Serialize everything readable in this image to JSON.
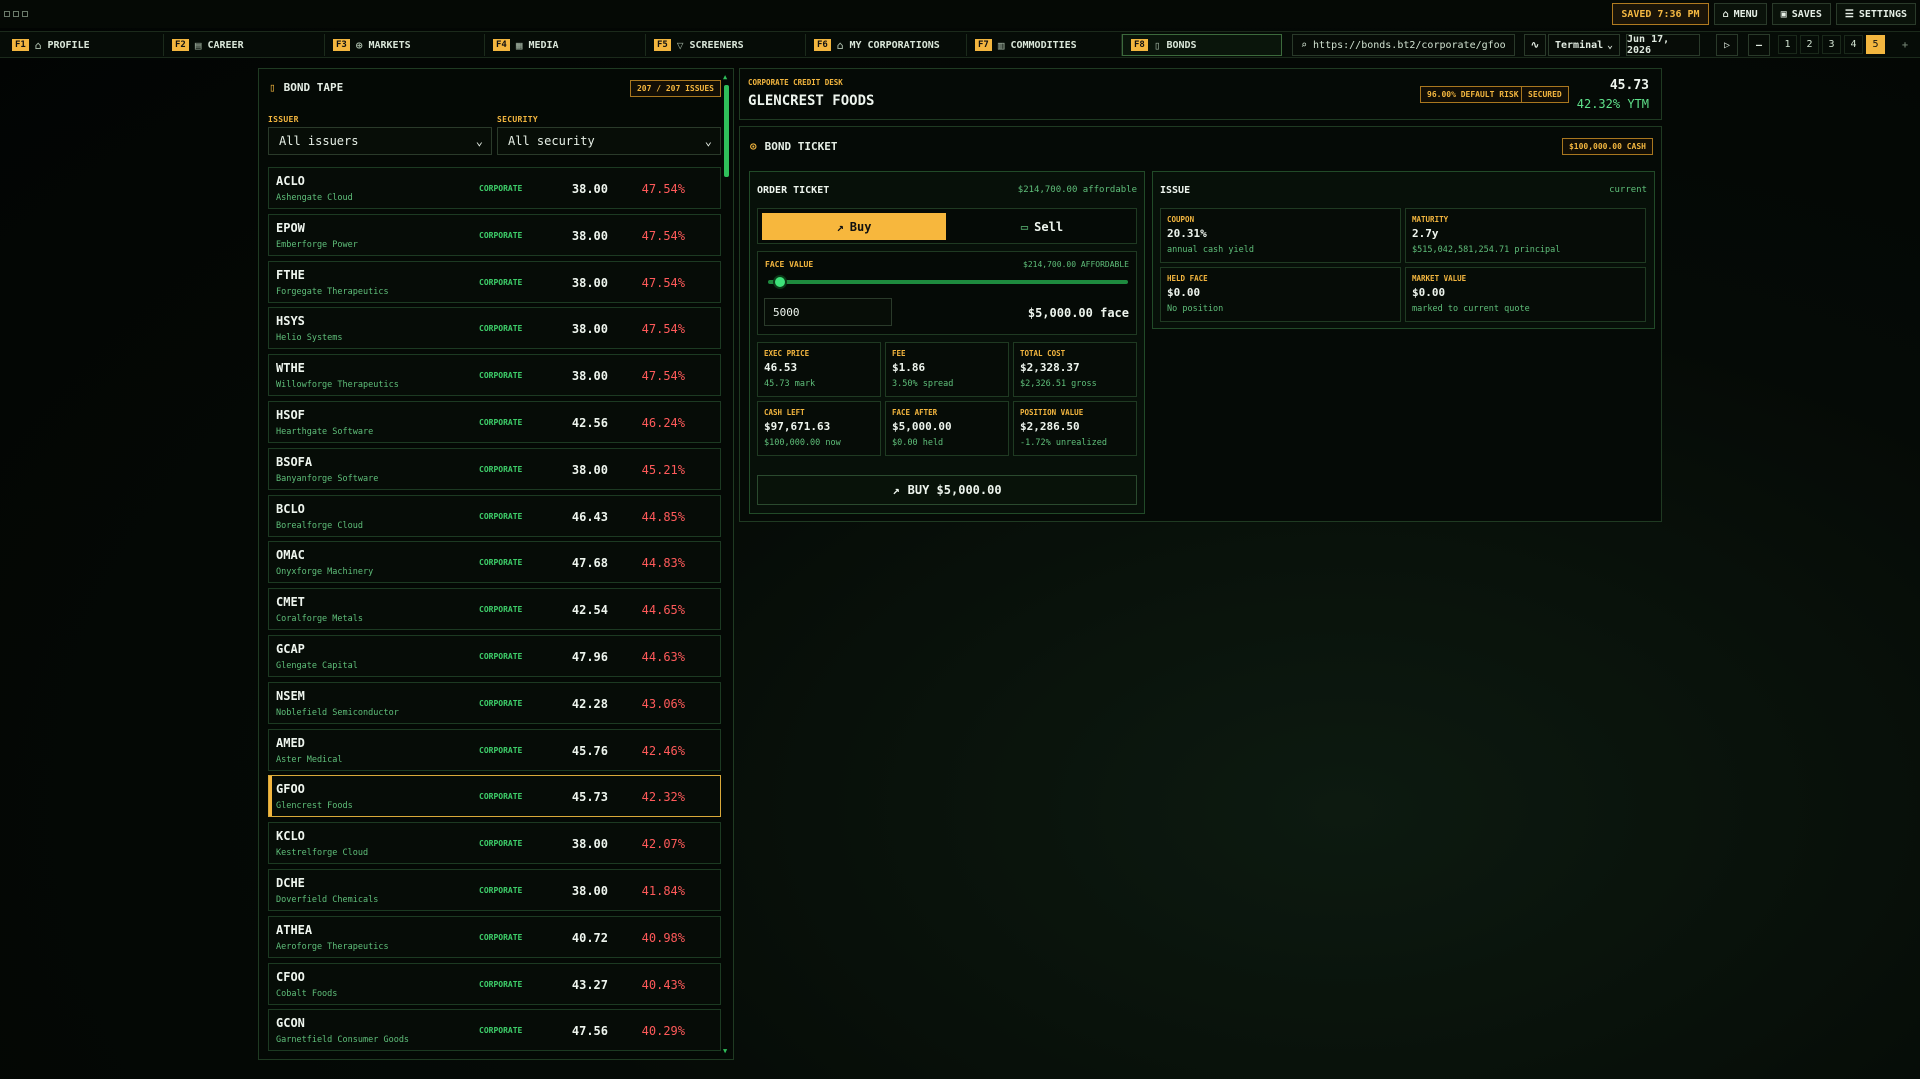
{
  "topbar": {
    "saved": "SAVED 7:36 PM",
    "menu": "MENU",
    "saves": "SAVES",
    "settings": "SETTINGS"
  },
  "tabs": [
    {
      "key": "F1",
      "label": "PROFILE",
      "icon": "home-icon"
    },
    {
      "key": "F2",
      "label": "CAREER",
      "icon": "briefcase-icon"
    },
    {
      "key": "F3",
      "label": "MARKETS",
      "icon": "globe-icon"
    },
    {
      "key": "F4",
      "label": "MEDIA",
      "icon": "newspaper-icon"
    },
    {
      "key": "F5",
      "label": "SCREENERS",
      "icon": "filter-icon"
    },
    {
      "key": "F6",
      "label": "MY CORPORATIONS",
      "icon": "bank-icon"
    },
    {
      "key": "F7",
      "label": "COMMODITIES",
      "icon": "factory-icon"
    },
    {
      "key": "F8",
      "label": "BONDS",
      "icon": "document-icon"
    }
  ],
  "toolbar": {
    "url": "https://bonds.bt2/corporate/gfoo",
    "mode": "Terminal",
    "date": "Jun 17, 2026",
    "speeds": [
      "1",
      "2",
      "3",
      "4",
      "5"
    ],
    "active_speed": "5"
  },
  "tape": {
    "title": "BOND TAPE",
    "count": "207 / 207 ISSUES",
    "issuer_label": "ISSUER",
    "issuer_value": "All issuers",
    "security_label": "SECURITY",
    "security_value": "All security",
    "rows": [
      {
        "ticker": "ACLO",
        "name": "Ashengate Cloud",
        "type": "CORPORATE",
        "price": "38.00",
        "yield": "47.54%"
      },
      {
        "ticker": "EPOW",
        "name": "Emberforge Power",
        "type": "CORPORATE",
        "price": "38.00",
        "yield": "47.54%"
      },
      {
        "ticker": "FTHE",
        "name": "Forgegate Therapeutics",
        "type": "CORPORATE",
        "price": "38.00",
        "yield": "47.54%"
      },
      {
        "ticker": "HSYS",
        "name": "Helio Systems",
        "type": "CORPORATE",
        "price": "38.00",
        "yield": "47.54%"
      },
      {
        "ticker": "WTHE",
        "name": "Willowforge Therapeutics",
        "type": "CORPORATE",
        "price": "38.00",
        "yield": "47.54%"
      },
      {
        "ticker": "HSOF",
        "name": "Hearthgate Software",
        "type": "CORPORATE",
        "price": "42.56",
        "yield": "46.24%"
      },
      {
        "ticker": "BSOFA",
        "name": "Banyanforge Software",
        "type": "CORPORATE",
        "price": "38.00",
        "yield": "45.21%"
      },
      {
        "ticker": "BCLO",
        "name": "Borealforge Cloud",
        "type": "CORPORATE",
        "price": "46.43",
        "yield": "44.85%"
      },
      {
        "ticker": "OMAC",
        "name": "Onyxforge Machinery",
        "type": "CORPORATE",
        "price": "47.68",
        "yield": "44.83%"
      },
      {
        "ticker": "CMET",
        "name": "Coralforge Metals",
        "type": "CORPORATE",
        "price": "42.54",
        "yield": "44.65%"
      },
      {
        "ticker": "GCAP",
        "name": "Glengate Capital",
        "type": "CORPORATE",
        "price": "47.96",
        "yield": "44.63%"
      },
      {
        "ticker": "NSEM",
        "name": "Noblefield Semiconductor",
        "type": "CORPORATE",
        "price": "42.28",
        "yield": "43.06%"
      },
      {
        "ticker": "AMED",
        "name": "Aster Medical",
        "type": "CORPORATE",
        "price": "45.76",
        "yield": "42.46%"
      },
      {
        "ticker": "GFOO",
        "name": "Glencrest Foods",
        "type": "CORPORATE",
        "price": "45.73",
        "yield": "42.32%",
        "selected": true
      },
      {
        "ticker": "KCLO",
        "name": "Kestrelforge Cloud",
        "type": "CORPORATE",
        "price": "38.00",
        "yield": "42.07%"
      },
      {
        "ticker": "DCHE",
        "name": "Doverfield Chemicals",
        "type": "CORPORATE",
        "price": "38.00",
        "yield": "41.84%"
      },
      {
        "ticker": "ATHEA",
        "name": "Aeroforge Therapeutics",
        "type": "CORPORATE",
        "price": "40.72",
        "yield": "40.98%"
      },
      {
        "ticker": "CFOO",
        "name": "Cobalt Foods",
        "type": "CORPORATE",
        "price": "43.27",
        "yield": "40.43%"
      },
      {
        "ticker": "GCON",
        "name": "Garnetfield Consumer Goods",
        "type": "CORPORATE",
        "price": "47.56",
        "yield": "40.29%"
      }
    ]
  },
  "header": {
    "desk": "CORPORATE CREDIT DESK",
    "company": "GLENCREST FOODS",
    "risk": "96.00% DEFAULT RISK",
    "secured": "SECURED",
    "price": "45.73",
    "ytm": "42.32% YTM"
  },
  "ticket": {
    "title": "BOND TICKET",
    "cash": "$100,000.00 CASH",
    "order": {
      "title": "ORDER TICKET",
      "affordable": "$214,700.00 affordable",
      "buy": "Buy",
      "sell": "Sell",
      "face_label": "FACE VALUE",
      "face_afford": "$214,700.00 AFFORDABLE",
      "slider_fraction": 0.023,
      "input_value": "5000",
      "face_text": "$5,000.00 face",
      "stats": [
        {
          "k": "EXEC PRICE",
          "v": "46.53",
          "s": "45.73 mark"
        },
        {
          "k": "FEE",
          "v": "$1.86",
          "s": "3.50% spread"
        },
        {
          "k": "TOTAL COST",
          "v": "$2,328.37",
          "s": "$2,326.51 gross"
        },
        {
          "k": "CASH LEFT",
          "v": "$97,671.63",
          "s": "$100,000.00 now"
        },
        {
          "k": "FACE AFTER",
          "v": "$5,000.00",
          "s": "$0.00 held"
        },
        {
          "k": "POSITION VALUE",
          "v": "$2,286.50",
          "s": "-1.72% unrealized"
        }
      ],
      "submit": "BUY $5,000.00"
    },
    "issue": {
      "title": "ISSUE",
      "tag": "current",
      "stats": [
        {
          "k": "COUPON",
          "v": "20.31%",
          "s": "annual cash yield"
        },
        {
          "k": "MATURITY",
          "v": "2.7y",
          "s": "$515,042,581,254.71 principal"
        },
        {
          "k": "HELD FACE",
          "v": "$0.00",
          "s": "No position"
        },
        {
          "k": "MARKET VALUE",
          "v": "$0.00",
          "s": "marked to current quote"
        }
      ]
    }
  }
}
